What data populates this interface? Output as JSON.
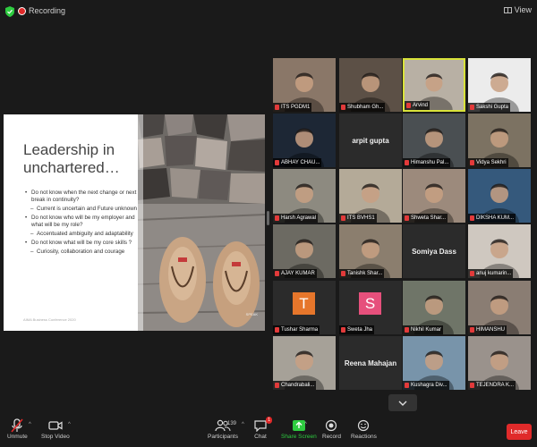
{
  "topbar": {
    "recording_label": "Recording",
    "view_label": "View"
  },
  "slide": {
    "title": "Leadership in unchartered…",
    "bullets": [
      {
        "text": "Do not know when the next change or next break in continuity?",
        "sub": false
      },
      {
        "text": "Current is uncertain and Future unknown",
        "sub": true
      },
      {
        "text": "Do not know who will be my employer and what will be my role?",
        "sub": false
      },
      {
        "text": "Accentuated ambiguity and adaptability",
        "sub": true
      },
      {
        "text": "Do not know what will be my core skills ?",
        "sub": false
      },
      {
        "text": "Curiosity, collaboration and courage",
        "sub": true
      }
    ],
    "footer": "AIMA Business Conference 2020",
    "mark": "SPEAK"
  },
  "participants": [
    {
      "name": "ITS PGDM1",
      "type": "video",
      "bg": "#8a7768"
    },
    {
      "name": "Shubham Gh...",
      "type": "video",
      "bg": "#5c5046"
    },
    {
      "name": "Arvind",
      "type": "video",
      "bg": "#b8b0a4",
      "active": true
    },
    {
      "name": "Sakshi Gupta",
      "type": "video",
      "bg": "#ececec"
    },
    {
      "name": "ABHAY CHAU...",
      "type": "video",
      "bg": "#1d2735"
    },
    {
      "name": "arpit gupta",
      "type": "name"
    },
    {
      "name": "Himanshu Pal...",
      "type": "video",
      "bg": "#4a4f52"
    },
    {
      "name": "Vidya Sekhri",
      "type": "video",
      "bg": "#7c7262"
    },
    {
      "name": "Harsh Agrawal",
      "type": "video",
      "bg": "#8d8a80"
    },
    {
      "name": "ITS BVHS1",
      "type": "video",
      "bg": "#b4aa98"
    },
    {
      "name": "Shweta Shar...",
      "type": "video",
      "bg": "#9c8a7c"
    },
    {
      "name": "DIKSHA KUM...",
      "type": "video",
      "bg": "#35597c"
    },
    {
      "name": "AJAY KUMAR",
      "type": "video",
      "bg": "#6c6a62"
    },
    {
      "name": "Tanishk Shar...",
      "type": "video",
      "bg": "#8b7e6e"
    },
    {
      "name": "Somiya Dass",
      "type": "name"
    },
    {
      "name": "anuj kumarin...",
      "type": "video",
      "bg": "#cfc8c0"
    },
    {
      "name": "Tushar Sharma",
      "type": "avatar",
      "letter": "T",
      "color": "#e6762b"
    },
    {
      "name": "Sweta Jha",
      "type": "avatar",
      "letter": "S",
      "color": "#e6507c"
    },
    {
      "name": "Nikhil Kumar",
      "type": "video",
      "bg": "#6f7568"
    },
    {
      "name": "HIMANSHU",
      "type": "video",
      "bg": "#8a7d73"
    },
    {
      "name": "Chandrabali...",
      "type": "video",
      "bg": "#a6a198"
    },
    {
      "name": "Reena Mahajan",
      "type": "name"
    },
    {
      "name": "Kushagra Div...",
      "type": "video",
      "bg": "#7894aa"
    },
    {
      "name": "TEJENDRA K...",
      "type": "video",
      "bg": "#9a928c"
    }
  ],
  "toolbar": {
    "unmute": "Unmute",
    "stop_video": "Stop Video",
    "participants": "Participants",
    "participants_count": "139",
    "chat": "Chat",
    "chat_badge": "1",
    "share_screen": "Share Screen",
    "record": "Record",
    "reactions": "Reactions",
    "leave": "Leave"
  }
}
